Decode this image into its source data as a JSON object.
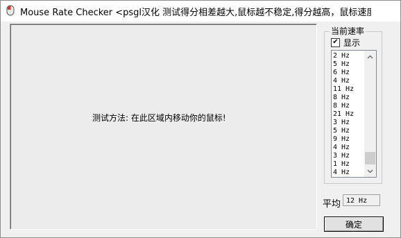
{
  "window": {
    "title": "Mouse Rate Checker <psgl汉化  测试得分相差越大,鼠标越不稳定,得分越高，鼠标速度越快>"
  },
  "test_area": {
    "instruction": "测试方法: 在此区域内移动你的鼠标!"
  },
  "rate_panel": {
    "group_title": "当前速率",
    "show_label": "显示",
    "show_checked": true,
    "rates": [
      "2 Hz",
      "5 Hz",
      "6 Hz",
      "4 Hz",
      "11 Hz",
      "8 Hz",
      "8 Hz",
      "21 Hz",
      "3 Hz",
      "5 Hz",
      "9 Hz",
      "4 Hz",
      "3 Hz",
      "1 Hz",
      "4 Hz"
    ]
  },
  "average": {
    "label": "平均",
    "value": "12 Hz"
  },
  "ok_button": {
    "label": "确定"
  },
  "icons": {
    "app": "mouse-app-icon",
    "close": "close-icon",
    "check": "checkmark-icon",
    "scroll_up": "chevron-up-icon",
    "scroll_down": "chevron-down-icon"
  }
}
